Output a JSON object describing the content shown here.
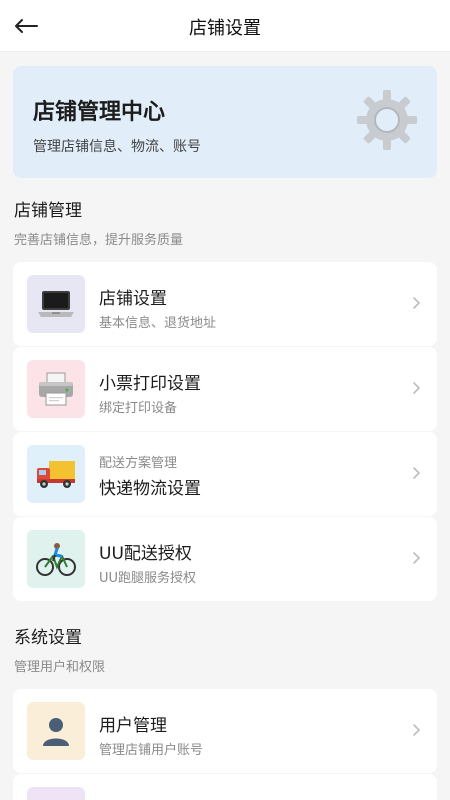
{
  "header": {
    "title": "店铺设置",
    "back_icon": "arrow-left-icon"
  },
  "hero": {
    "title": "店铺管理中心",
    "subtitle": "管理店铺信息、物流、账号",
    "icon": "gear-icon"
  },
  "sections": [
    {
      "title": "店铺管理",
      "subtitle": "完善店铺信息，提升服务质量",
      "items": [
        {
          "title": "店铺设置",
          "subtitle": "基本信息、退货地址",
          "icon": "laptop-icon"
        },
        {
          "title": "小票打印设置",
          "subtitle": "绑定打印设备",
          "icon": "printer-icon"
        },
        {
          "title": "快递物流设置",
          "subtitle": "配送方案管理",
          "icon": "delivery-truck-icon"
        },
        {
          "title": "UU配送授权",
          "subtitle": "UU跑腿服务授权",
          "icon": "cyclist-icon"
        }
      ]
    },
    {
      "title": "系统设置",
      "subtitle": "管理用户和权限",
      "items": [
        {
          "title": "用户管理",
          "subtitle": "管理店铺用户账号",
          "icon": "user-icon"
        }
      ]
    }
  ],
  "colors": {
    "background": "#f5f5f5",
    "hero": "#e1eefa",
    "card": "#ffffff"
  }
}
